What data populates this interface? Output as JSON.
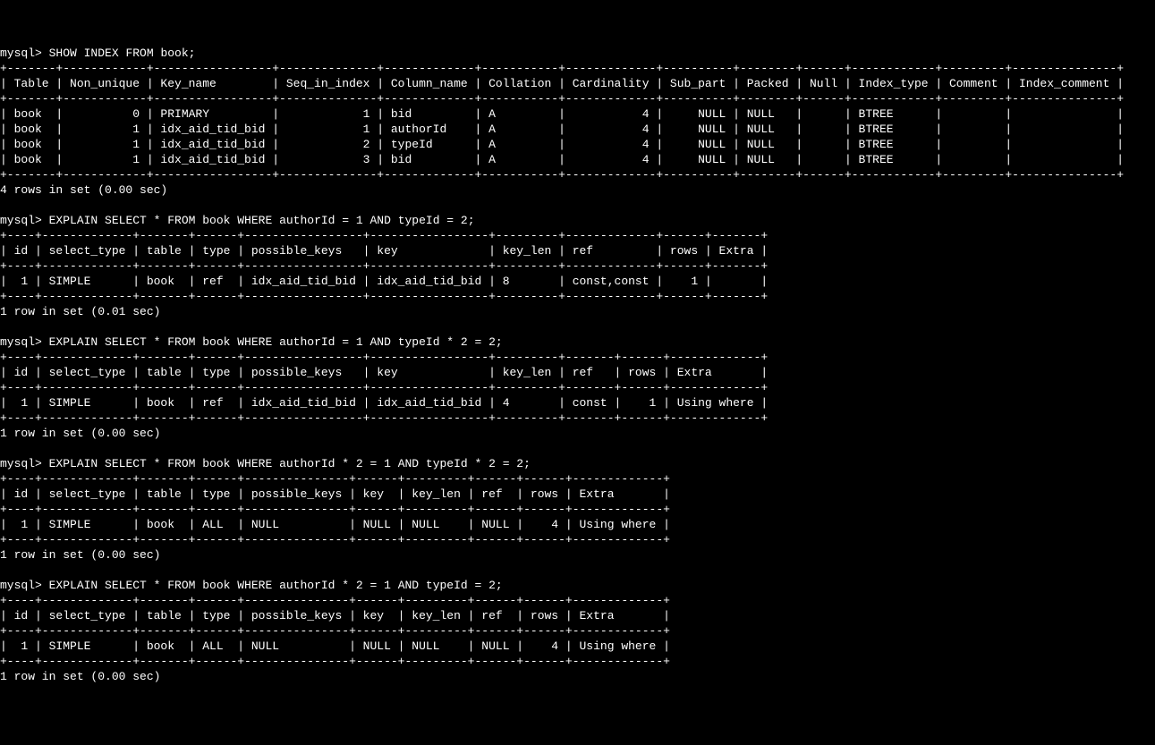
{
  "prompt": "mysql>",
  "commands": {
    "cmd1": "SHOW INDEX FROM book;",
    "cmd2": "EXPLAIN SELECT * FROM book WHERE authorId = 1 AND typeId = 2;",
    "cmd3": "EXPLAIN SELECT * FROM book WHERE authorId = 1 AND typeId * 2 = 2;",
    "cmd4": "EXPLAIN SELECT * FROM book WHERE authorId * 2 = 1 AND typeId * 2 = 2;",
    "cmd5": "EXPLAIN SELECT * FROM book WHERE authorId * 2 = 1 AND typeId = 2;"
  },
  "show_index": {
    "border": "+-------+------------+-----------------+--------------+-------------+-----------+-------------+----------+--------+------+------------+---------+---------------+",
    "header": "| Table | Non_unique | Key_name        | Seq_in_index | Column_name | Collation | Cardinality | Sub_part | Packed | Null | Index_type | Comment | Index_comment |",
    "rows": [
      "| book  |          0 | PRIMARY         |            1 | bid         | A         |           4 |     NULL | NULL   |      | BTREE      |         |               |",
      "| book  |          1 | idx_aid_tid_bid |            1 | authorId    | A         |           4 |     NULL | NULL   |      | BTREE      |         |               |",
      "| book  |          1 | idx_aid_tid_bid |            2 | typeId      | A         |           4 |     NULL | NULL   |      | BTREE      |         |               |",
      "| book  |          1 | idx_aid_tid_bid |            3 | bid         | A         |           4 |     NULL | NULL   |      | BTREE      |         |               |"
    ],
    "footer": "4 rows in set (0.00 sec)"
  },
  "explain1": {
    "border": "+----+-------------+-------+------+-----------------+-----------------+---------+-------------+------+-------+",
    "header": "| id | select_type | table | type | possible_keys   | key             | key_len | ref         | rows | Extra |",
    "row": "|  1 | SIMPLE      | book  | ref  | idx_aid_tid_bid | idx_aid_tid_bid | 8       | const,const |    1 |       |",
    "footer": "1 row in set (0.01 sec)"
  },
  "explain2": {
    "border": "+----+-------------+-------+------+-----------------+-----------------+---------+-------+------+-------------+",
    "header": "| id | select_type | table | type | possible_keys   | key             | key_len | ref   | rows | Extra       |",
    "row": "|  1 | SIMPLE      | book  | ref  | idx_aid_tid_bid | idx_aid_tid_bid | 4       | const |    1 | Using where |",
    "footer": "1 row in set (0.00 sec)"
  },
  "explain3": {
    "border": "+----+-------------+-------+------+---------------+------+---------+------+------+-------------+",
    "header": "| id | select_type | table | type | possible_keys | key  | key_len | ref  | rows | Extra       |",
    "row": "|  1 | SIMPLE      | book  | ALL  | NULL          | NULL | NULL    | NULL |    4 | Using where |",
    "footer": "1 row in set (0.00 sec)"
  },
  "explain4": {
    "border": "+----+-------------+-------+------+---------------+------+---------+------+------+-------------+",
    "header": "| id | select_type | table | type | possible_keys | key  | key_len | ref  | rows | Extra       |",
    "row": "|  1 | SIMPLE      | book  | ALL  | NULL          | NULL | NULL    | NULL |    4 | Using where |",
    "footer": "1 row in set (0.00 sec)"
  }
}
